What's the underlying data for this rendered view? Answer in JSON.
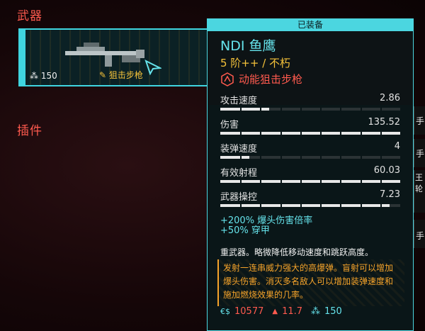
{
  "sections": {
    "weapons": "武器",
    "mods": "插件"
  },
  "card": {
    "ammo": "150",
    "type": "狙击步枪"
  },
  "tooltip": {
    "header": "已装备",
    "name": "NDI 鱼鹰",
    "tier": "5 阶++ / 不朽",
    "class": "动能狙击步枪",
    "stats": [
      {
        "label": "攻击速度",
        "value": "2.86",
        "fill": 0.27
      },
      {
        "label": "伤害",
        "value": "135.52",
        "fill": 1.0
      },
      {
        "label": "装弹速度",
        "value": "4",
        "fill": 0.16
      },
      {
        "label": "有效射程",
        "value": "60.03",
        "fill": 1.0
      },
      {
        "label": "武器操控",
        "value": "7.23",
        "fill": 0.94
      }
    ],
    "bonus1": "+200% 爆头伤害倍率",
    "bonus2": "+50% 穿甲",
    "desc": "重武器。略微降低移动速度和跳跃高度。",
    "lore": "发射一连串威力强大的高爆弹。盲射可以增加爆头伤害。消灭多名敌人可以增加装弹速度和施加燃烧效果的几率。",
    "price": "10577",
    "weight": "11.7",
    "ammo": "150"
  },
  "edge": {
    "label1": "手",
    "label2": "手",
    "label3": "手",
    "label4": "王轮"
  },
  "colors": {
    "accent": "#4bd6e0",
    "red": "#ff5a4e",
    "yellow": "#f5c23a"
  }
}
